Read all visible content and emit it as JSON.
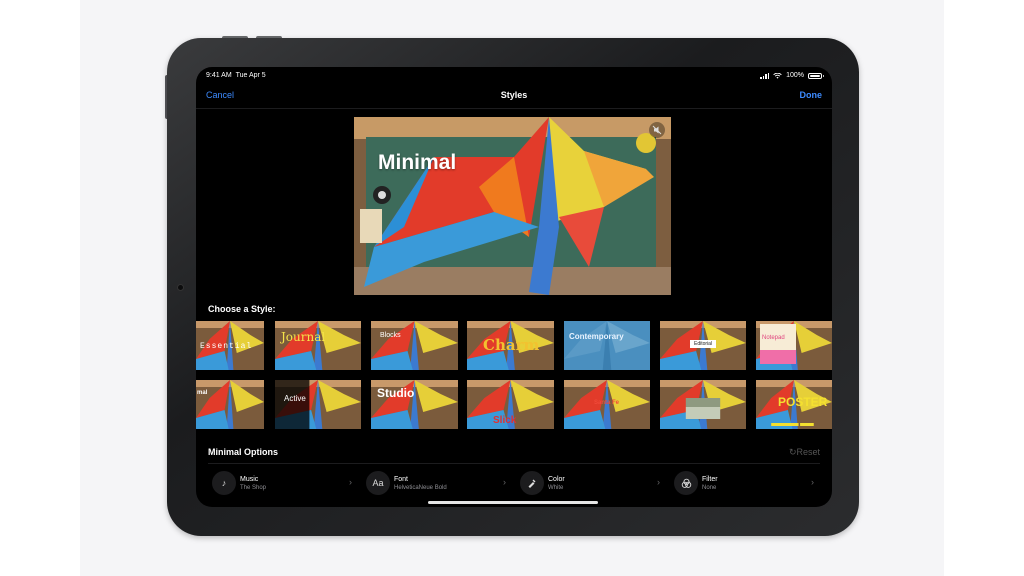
{
  "status_bar": {
    "time": "9:41 AM",
    "date": "Tue Apr 5",
    "battery": "100%"
  },
  "nav": {
    "cancel": "Cancel",
    "title": "Styles",
    "done": "Done"
  },
  "preview": {
    "title": "Minimal"
  },
  "choose_label": "Choose a Style:",
  "styles_row1": [
    {
      "label": "Essential"
    },
    {
      "label": "Journal"
    },
    {
      "label": "Blocks"
    },
    {
      "label": "Charm"
    },
    {
      "label": "Contemporary"
    },
    {
      "label": "Editorial"
    },
    {
      "label": "Notepad"
    }
  ],
  "styles_row2": [
    {
      "label": "mal"
    },
    {
      "label": "Active"
    },
    {
      "label": "Studio"
    },
    {
      "label": "Slick"
    },
    {
      "label": "Santa Fe"
    },
    {
      "label": ""
    },
    {
      "label": "POSTER"
    }
  ],
  "selected_style": "Studio",
  "options": {
    "title": "Minimal Options",
    "reset": "Reset",
    "items": [
      {
        "name": "Music",
        "value": "The Shop",
        "icon": "music-note-icon"
      },
      {
        "name": "Font",
        "value": "HelveticaNeue Bold",
        "icon": "font-aa-icon",
        "glyph": "Aa"
      },
      {
        "name": "Color",
        "value": "White",
        "icon": "eyedropper-icon"
      },
      {
        "name": "Filter",
        "value": "None",
        "icon": "filter-circles-icon"
      }
    ]
  },
  "colors": {
    "accent": "#3d8bff",
    "selected_outline": "#f2a541"
  }
}
